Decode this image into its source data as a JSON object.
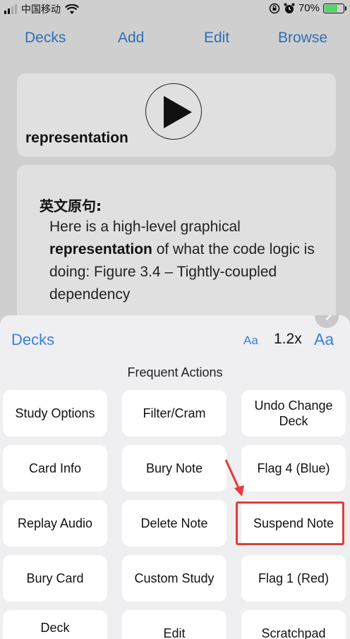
{
  "status_bar": {
    "carrier": "中国移动",
    "battery_percent": "70%",
    "battery_level": 0.7
  },
  "nav": {
    "decks": "Decks",
    "add": "Add",
    "edit": "Edit",
    "browse": "Browse"
  },
  "card_front": {
    "word": "representation"
  },
  "card_back": {
    "label": "英文原句:",
    "sentence_before": " Here is a high-level graphical ",
    "sentence_bold": "representation",
    "sentence_after": " of what the code logic is doing: Figure 3.4 – Tightly-coupled dependency"
  },
  "sheet": {
    "decks": "Decks",
    "aa_small": "Aa",
    "zoom": "1.2x",
    "aa_big": "Aa",
    "section_title": "Frequent Actions"
  },
  "actions": [
    "Study Options",
    "Filter/Cram",
    "Undo Change Deck",
    "Card Info",
    "Bury Note",
    "Flag 4 (Blue)",
    "Replay Audio",
    "Delete Note",
    "Suspend Note",
    "Bury Card",
    "Custom Study",
    "Flag 1 (Red)",
    "Deck",
    "Edit",
    "Scratchpad"
  ],
  "colors": {
    "accent": "#3a80d9",
    "highlight": "#e23b3b"
  }
}
